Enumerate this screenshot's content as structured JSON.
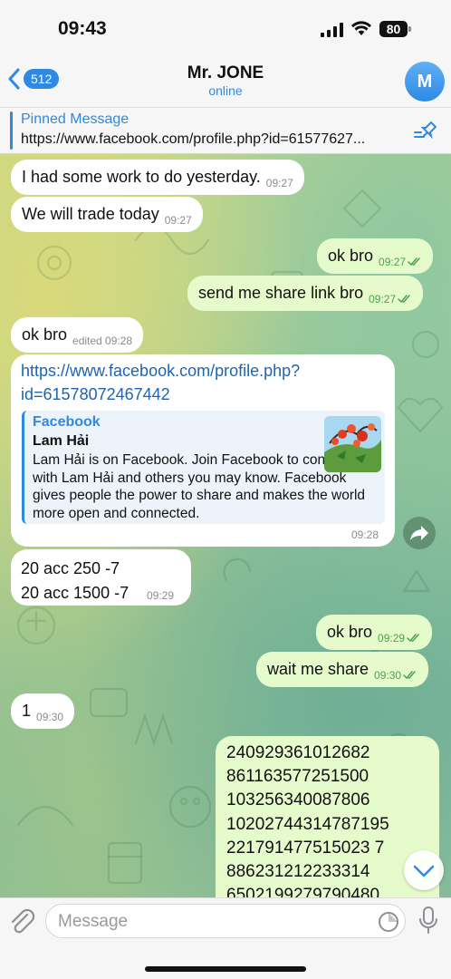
{
  "status": {
    "time": "09:43",
    "battery": "80"
  },
  "header": {
    "back_count": "512",
    "name": "Mr. JONE",
    "status": "online",
    "avatar_letter": "M"
  },
  "pinned": {
    "title": "Pinned Message",
    "text": "https://www.facebook.com/profile.php?id=61577627..."
  },
  "messages": [
    {
      "dir": "in",
      "text": "I had some work to do yesterday.",
      "time": "09:27"
    },
    {
      "dir": "in",
      "text": "We will trade today",
      "time": "09:27"
    },
    {
      "dir": "out",
      "text": "ok bro",
      "time": "09:27",
      "read": true
    },
    {
      "dir": "out",
      "text": "send me share link bro",
      "time": "09:27",
      "read": true
    },
    {
      "dir": "in",
      "text": "ok bro",
      "time": "edited 09:28"
    },
    {
      "dir": "in",
      "link_line1": "https://www.facebook.com/profile.php?",
      "link_line2": "id=61578072467442",
      "time": "09:28",
      "preview": {
        "site": "Facebook",
        "title": "Lam Hải",
        "description": "Lam Hải is on Facebook. Join Facebook to connect with Lam Hải and others you may know. Facebook gives people the power to share and makes the world more open and connected."
      }
    },
    {
      "dir": "in",
      "line1": "20 acc 250 -7",
      "line2": "20 acc 1500 -7",
      "time": "09:29"
    },
    {
      "dir": "out",
      "text": "ok bro",
      "time": "09:29",
      "read": true
    },
    {
      "dir": "out",
      "text": "wait me share",
      "time": "09:30",
      "read": true
    },
    {
      "dir": "in",
      "text": "1",
      "time": "09:30"
    },
    {
      "dir": "out",
      "numbers": [
        "240929361012682",
        "861163577251500",
        "103256340087806",
        "10202744314787195",
        "221791477515023 7",
        "886231212233314",
        "6502199279790480"
      ]
    }
  ],
  "input": {
    "placeholder": "Message"
  },
  "colors": {
    "accent": "#2f89e3",
    "outgoing_bubble": "#e6fbcc",
    "incoming_bubble": "#ffffff"
  }
}
